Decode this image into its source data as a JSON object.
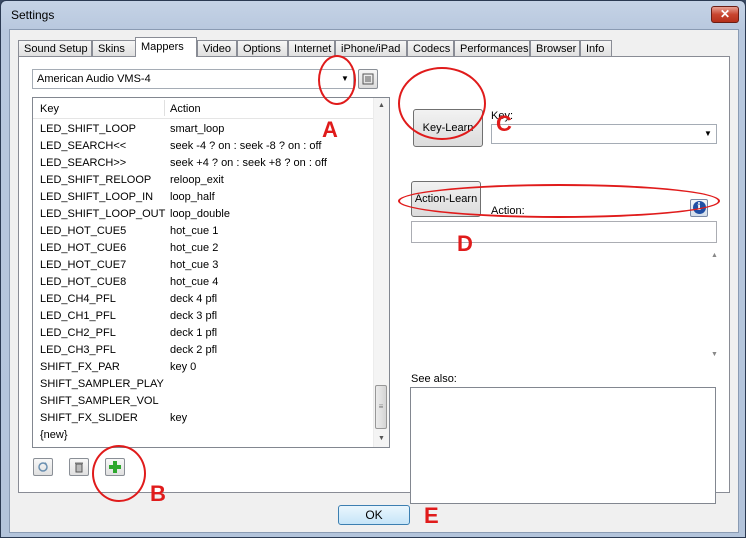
{
  "window": {
    "title": "Settings",
    "close_glyph": "✕"
  },
  "tabs": [
    {
      "label": "Sound Setup",
      "active": false
    },
    {
      "label": "Skins",
      "active": false
    },
    {
      "label": "Mappers",
      "active": true
    },
    {
      "label": "Video",
      "active": false
    },
    {
      "label": "Options",
      "active": false
    },
    {
      "label": "Internet",
      "active": false
    },
    {
      "label": "iPhone/iPad",
      "active": false
    },
    {
      "label": "Codecs",
      "active": false
    },
    {
      "label": "Performances",
      "active": false
    },
    {
      "label": "Browser",
      "active": false
    },
    {
      "label": "Info",
      "active": false
    }
  ],
  "mappers": {
    "device_select": {
      "value": "American Audio VMS-4"
    },
    "list": {
      "headers": {
        "key": "Key",
        "action": "Action"
      },
      "rows": [
        {
          "key": "LED_SHIFT_LOOP",
          "action": "smart_loop"
        },
        {
          "key": "LED_SEARCH<<",
          "action": "seek -4 ? on : seek -8 ? on : off"
        },
        {
          "key": "LED_SEARCH>>",
          "action": "seek +4 ? on : seek +8 ? on : off"
        },
        {
          "key": "LED_SHIFT_RELOOP",
          "action": "reloop_exit"
        },
        {
          "key": "LED_SHIFT_LOOP_IN",
          "action": "loop_half"
        },
        {
          "key": "LED_SHIFT_LOOP_OUT",
          "action": "loop_double"
        },
        {
          "key": "LED_HOT_CUE5",
          "action": "hot_cue 1"
        },
        {
          "key": "LED_HOT_CUE6",
          "action": "hot_cue 2"
        },
        {
          "key": "LED_HOT_CUE7",
          "action": "hot_cue 3"
        },
        {
          "key": "LED_HOT_CUE8",
          "action": "hot_cue 4"
        },
        {
          "key": "LED_CH4_PFL",
          "action": "deck 4 pfl"
        },
        {
          "key": "LED_CH1_PFL",
          "action": "deck 3 pfl"
        },
        {
          "key": "LED_CH2_PFL",
          "action": "deck 1 pfl"
        },
        {
          "key": "LED_CH3_PFL",
          "action": "deck 2 pfl"
        },
        {
          "key": "SHIFT_FX_PAR",
          "action": "key 0"
        },
        {
          "key": "SHIFT_SAMPLER_PLAY",
          "action": ""
        },
        {
          "key": "SHIFT_SAMPLER_VOL",
          "action": ""
        },
        {
          "key": "SHIFT_FX_SLIDER",
          "action": "key"
        },
        {
          "key": "{new}",
          "action": ""
        }
      ]
    },
    "key_learn_label": "Key-Learn",
    "key_label": "Key:",
    "key_value": "",
    "action_learn_label": "Action-Learn",
    "action_label": "Action:",
    "action_value": "",
    "see_also_label": "See also:"
  },
  "buttons": {
    "ok_label": "OK"
  },
  "annotations": {
    "a": "A",
    "b": "B",
    "c": "C",
    "d": "D",
    "e": "E"
  },
  "colors": {
    "annotation_red": "#e01b1b",
    "title_bar": "#c5d3e6",
    "add_green": "#2fa82f"
  }
}
